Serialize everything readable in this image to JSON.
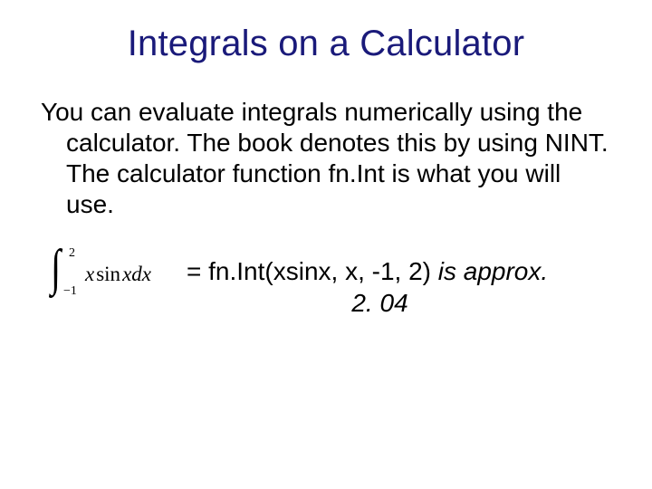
{
  "title": "Integrals on a Calculator",
  "body": "You can evaluate integrals numerically using the calculator.  The book denotes this by using NINT.  The calculator function fn.Int is what you will use.",
  "example": {
    "integral": {
      "upper": "2",
      "lower": "−1",
      "x1": "x",
      "sin": "sin",
      "x2": "x",
      "dx": "dx"
    },
    "equals": "= fn.Int(xsinx, x, -1, 2)",
    "approx": " is approx.",
    "result": "2. 04"
  }
}
